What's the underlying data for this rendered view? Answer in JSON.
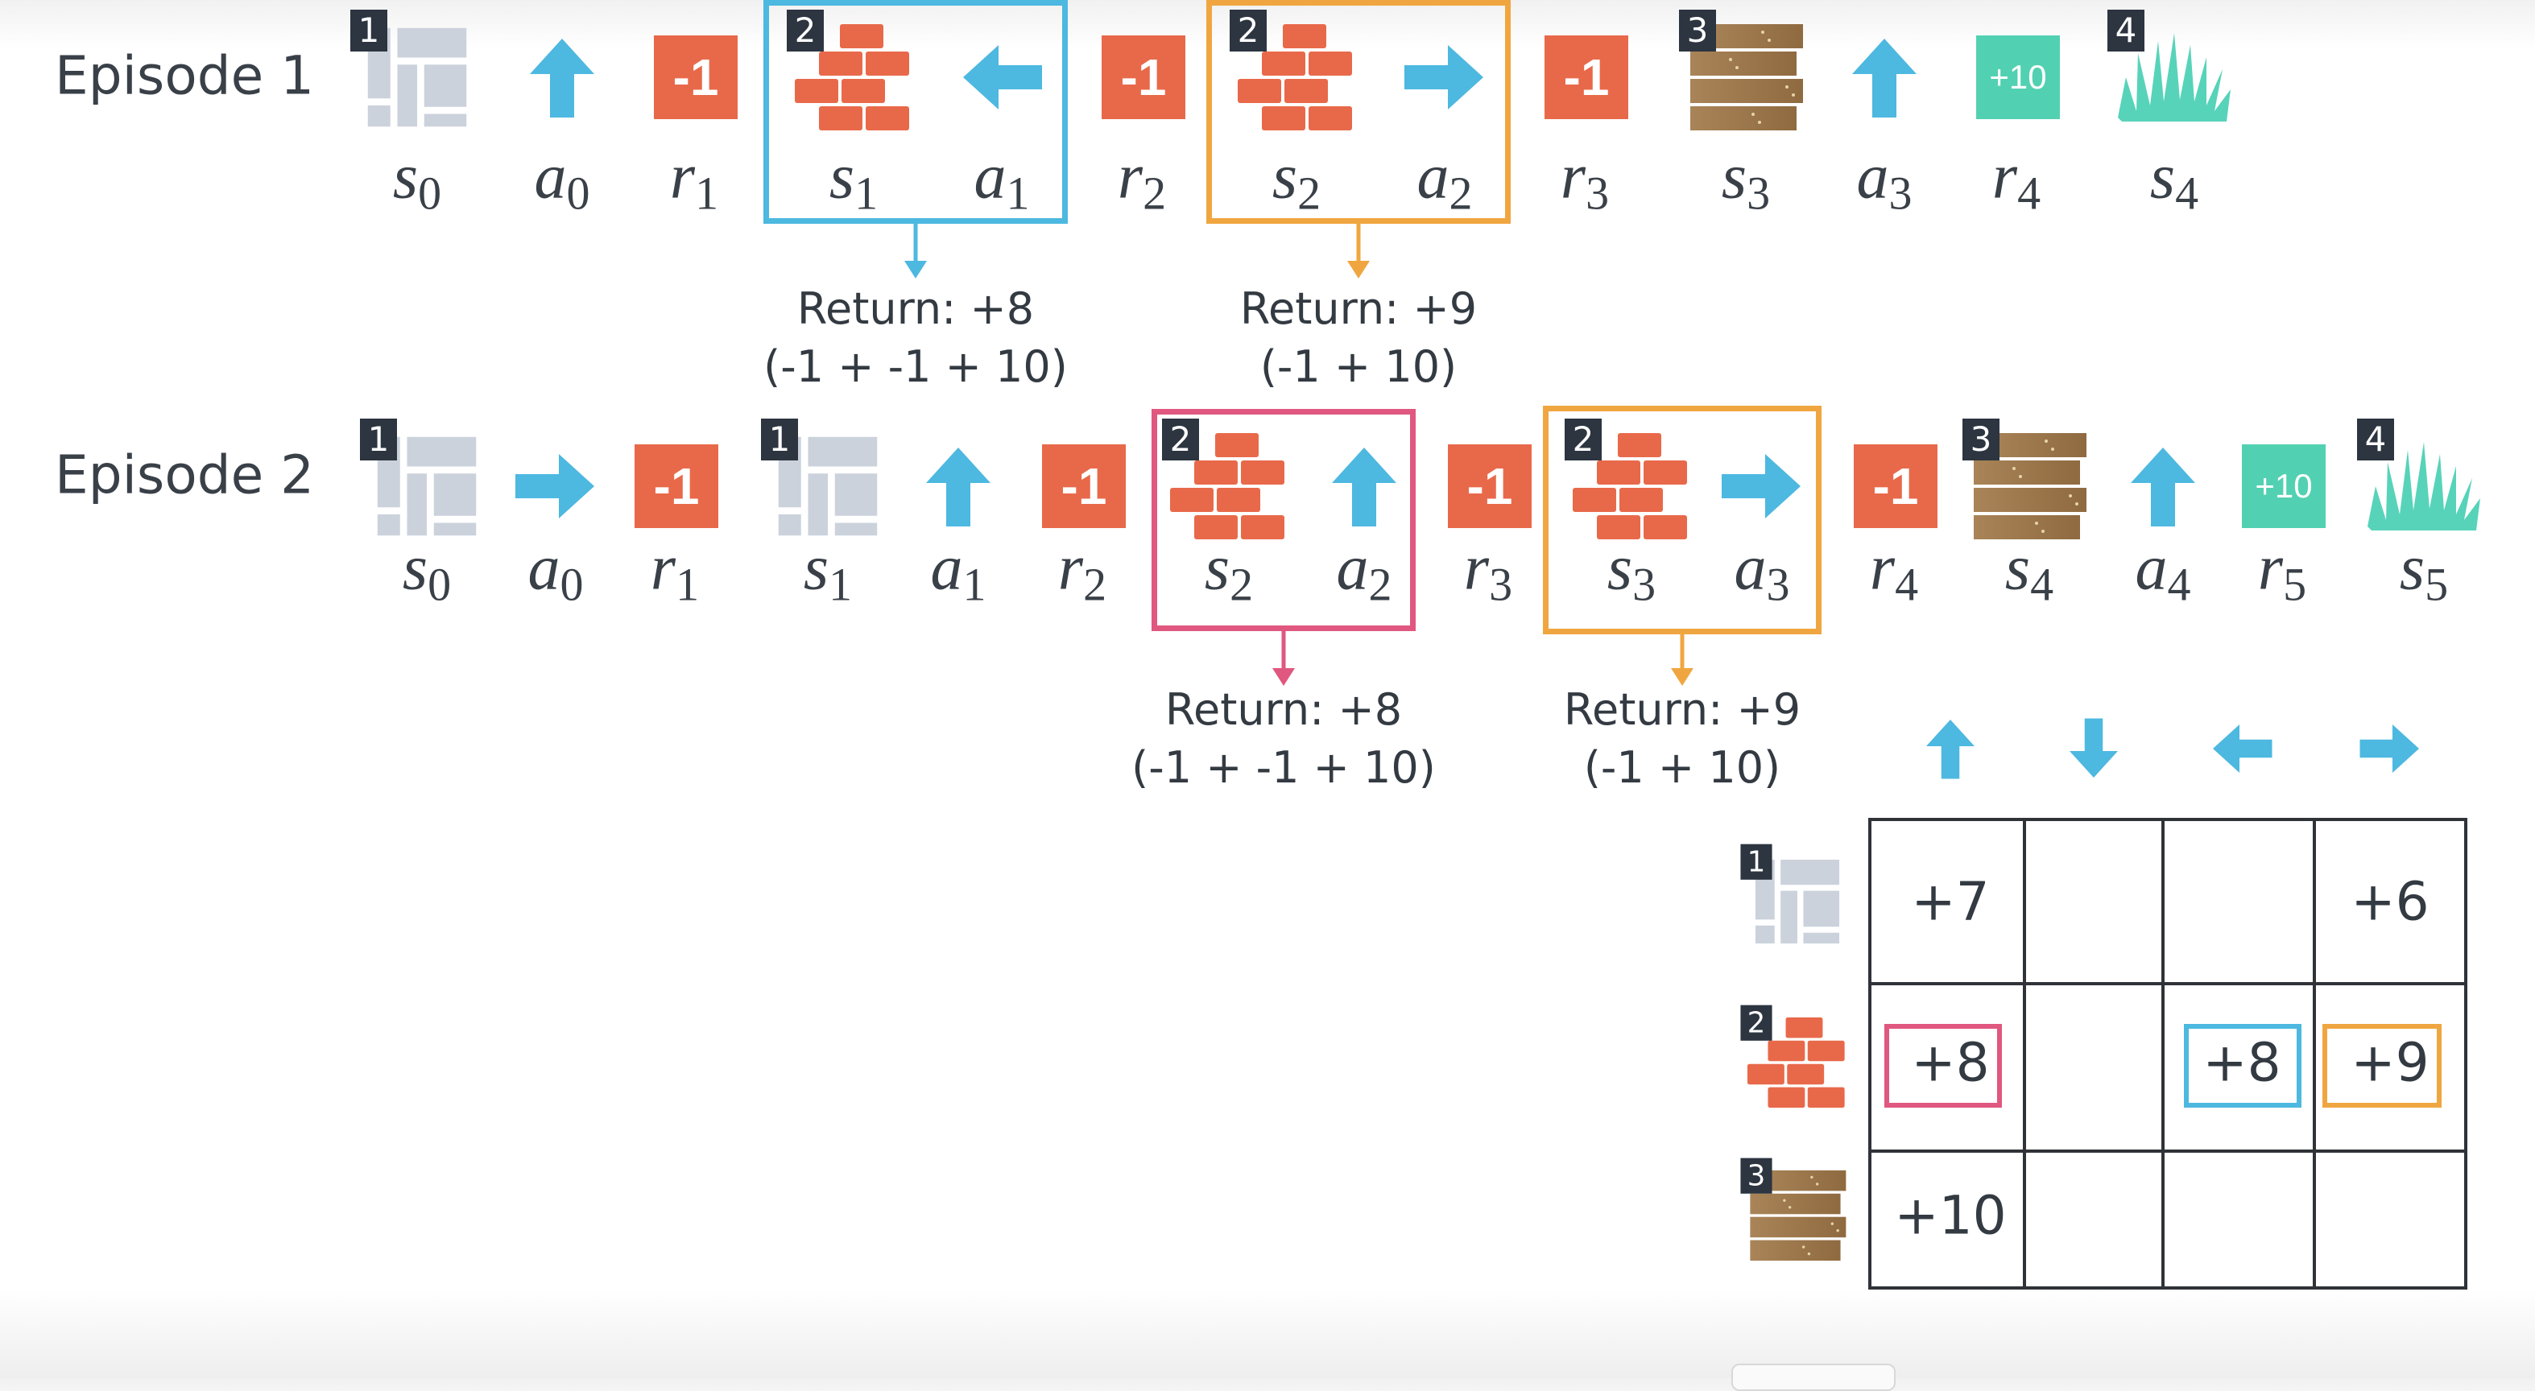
{
  "colors": {
    "action": "#4db8e0",
    "penalty": "#e8694a",
    "reward_pos": "#52d1b2",
    "badge": "#2c3540",
    "concrete": "#cbd2dc",
    "brick": "#e8694a",
    "wood": "#8f6a40",
    "grass": "#57d3b9",
    "blue_highlight": "#4db8e0",
    "orange_highlight": "#f0a640",
    "pink_highlight": "#e0577f"
  },
  "episodes": [
    {
      "label": "Episode 1",
      "steps": [
        {
          "type": "state",
          "sym": "s",
          "sub": "0",
          "icon": "concrete-icon",
          "badge": "1"
        },
        {
          "type": "action",
          "sym": "a",
          "sub": "0",
          "icon": "arrow-up-icon"
        },
        {
          "type": "reward",
          "sym": "r",
          "sub": "1",
          "value": "-1"
        },
        {
          "type": "state",
          "sym": "s",
          "sub": "1",
          "icon": "brick-icon",
          "badge": "2"
        },
        {
          "type": "action",
          "sym": "a",
          "sub": "1",
          "icon": "arrow-left-icon"
        },
        {
          "type": "reward",
          "sym": "r",
          "sub": "2",
          "value": "-1"
        },
        {
          "type": "state",
          "sym": "s",
          "sub": "2",
          "icon": "brick-icon",
          "badge": "2"
        },
        {
          "type": "action",
          "sym": "a",
          "sub": "2",
          "icon": "arrow-right-icon"
        },
        {
          "type": "reward",
          "sym": "r",
          "sub": "3",
          "value": "-1"
        },
        {
          "type": "state",
          "sym": "s",
          "sub": "3",
          "icon": "wood-icon",
          "badge": "3"
        },
        {
          "type": "action",
          "sym": "a",
          "sub": "3",
          "icon": "arrow-up-icon"
        },
        {
          "type": "reward",
          "sym": "r",
          "sub": "4",
          "value": "+10"
        },
        {
          "type": "state",
          "sym": "s",
          "sub": "4",
          "icon": "grass-icon",
          "badge": "4"
        }
      ],
      "highlights": [
        {
          "pair": "s1,a1",
          "color": "blue",
          "return_label": "Return: +8",
          "formula": "(-1 + -1 + 10)"
        },
        {
          "pair": "s2,a2",
          "color": "orange",
          "return_label": "Return: +9",
          "formula": "(-1 + 10)"
        }
      ]
    },
    {
      "label": "Episode 2",
      "steps": [
        {
          "type": "state",
          "sym": "s",
          "sub": "0",
          "icon": "concrete-icon",
          "badge": "1"
        },
        {
          "type": "action",
          "sym": "a",
          "sub": "0",
          "icon": "arrow-right-icon"
        },
        {
          "type": "reward",
          "sym": "r",
          "sub": "1",
          "value": "-1"
        },
        {
          "type": "state",
          "sym": "s",
          "sub": "1",
          "icon": "concrete-icon",
          "badge": "1"
        },
        {
          "type": "action",
          "sym": "a",
          "sub": "1",
          "icon": "arrow-up-icon"
        },
        {
          "type": "reward",
          "sym": "r",
          "sub": "2",
          "value": "-1"
        },
        {
          "type": "state",
          "sym": "s",
          "sub": "2",
          "icon": "brick-icon",
          "badge": "2"
        },
        {
          "type": "action",
          "sym": "a",
          "sub": "2",
          "icon": "arrow-up-icon"
        },
        {
          "type": "reward",
          "sym": "r",
          "sub": "3",
          "value": "-1"
        },
        {
          "type": "state",
          "sym": "s",
          "sub": "3",
          "icon": "brick-icon",
          "badge": "2"
        },
        {
          "type": "action",
          "sym": "a",
          "sub": "3",
          "icon": "arrow-right-icon"
        },
        {
          "type": "reward",
          "sym": "r",
          "sub": "4",
          "value": "-1"
        },
        {
          "type": "state",
          "sym": "s",
          "sub": "4",
          "icon": "wood-icon",
          "badge": "3"
        },
        {
          "type": "action",
          "sym": "a",
          "sub": "4",
          "icon": "arrow-up-icon"
        },
        {
          "type": "reward",
          "sym": "r",
          "sub": "5",
          "value": "+10"
        },
        {
          "type": "state",
          "sym": "s",
          "sub": "5",
          "icon": "grass-icon",
          "badge": "4"
        }
      ],
      "highlights": [
        {
          "pair": "s2,a2",
          "color": "pink",
          "return_label": "Return: +8",
          "formula": "(-1 + -1 + 10)"
        },
        {
          "pair": "s3,a3",
          "color": "orange",
          "return_label": "Return: +9",
          "formula": "(-1 + 10)"
        }
      ]
    }
  ],
  "q_table": {
    "actions": [
      "arrow-up-icon",
      "arrow-down-icon",
      "arrow-left-icon",
      "arrow-right-icon"
    ],
    "rows": [
      {
        "badge": "1",
        "icon": "concrete-icon",
        "cells": [
          "+7",
          "",
          "",
          "+6"
        ],
        "highlight": [
          null,
          null,
          null,
          null
        ]
      },
      {
        "badge": "2",
        "icon": "brick-icon",
        "cells": [
          "+8",
          "",
          "+8",
          "+9"
        ],
        "highlight": [
          "pink",
          null,
          "blue",
          "orange"
        ]
      },
      {
        "badge": "3",
        "icon": "wood-icon",
        "cells": [
          "+10",
          "",
          "",
          ""
        ],
        "highlight": [
          null,
          null,
          null,
          null
        ]
      }
    ]
  }
}
